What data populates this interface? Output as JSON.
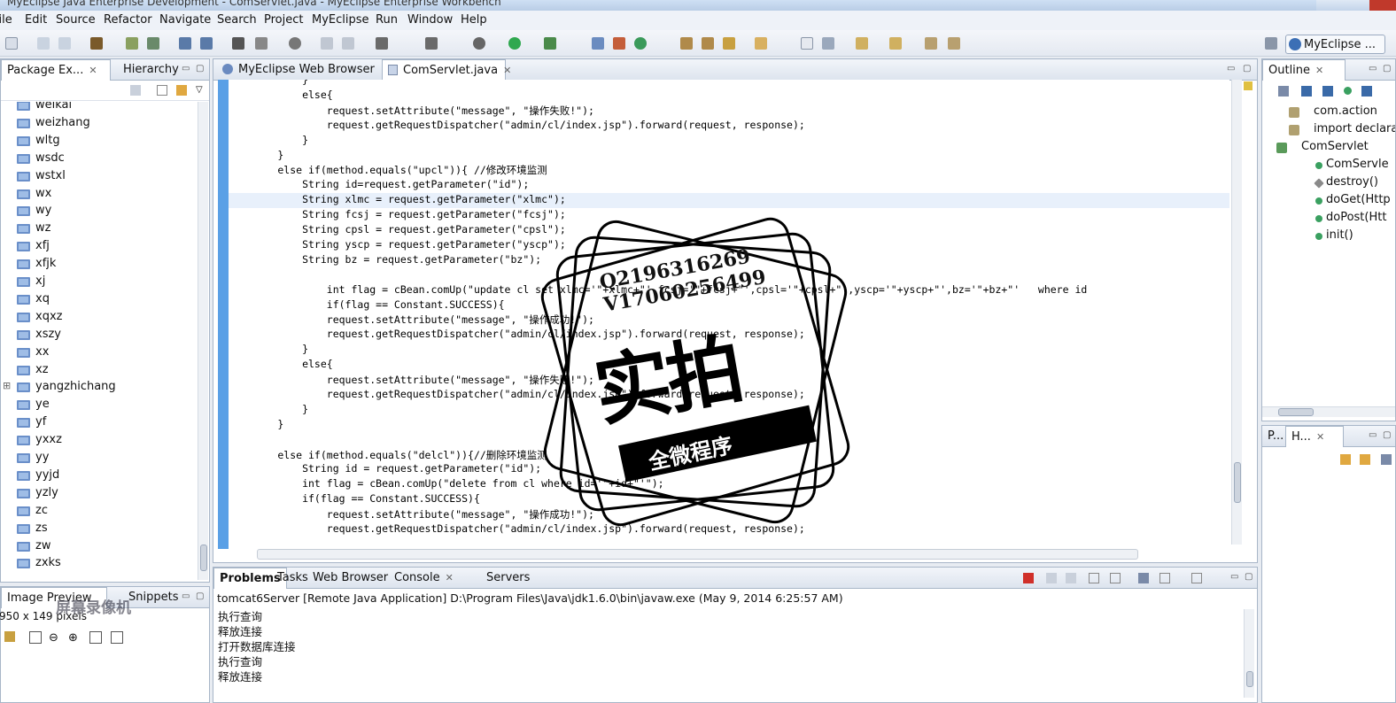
{
  "window": {
    "title": "MyEclipse Java Enterprise Development - ComServlet.java - MyEclipse Enterprise Workbench"
  },
  "menu": [
    "File",
    "Edit",
    "Source",
    "Refactor",
    "Navigate",
    "Search",
    "Project",
    "MyEclipse",
    "Run",
    "Window",
    "Help"
  ],
  "perspective": {
    "label": "MyEclipse ..."
  },
  "package_explorer": {
    "tabs": [
      "Package Ex...",
      "Hierarchy"
    ],
    "items": [
      "weikai",
      "weizhang",
      "wltg",
      "wsdc",
      "wstxl",
      "wx",
      "wy",
      "wz",
      "xfj",
      "xfjk",
      "xj",
      "xq",
      "xqxz",
      "xszy",
      "xx",
      "xz",
      "yangzhichang",
      "ye",
      "yf",
      "yxxz",
      "yy",
      "yyjd",
      "yzly",
      "zc",
      "zs",
      "zw",
      "zxks"
    ]
  },
  "image_preview": {
    "tabs": [
      "Image Preview",
      "Snippets"
    ],
    "size_text": "950 x 149 pixels"
  },
  "editor": {
    "tabs": [
      "MyEclipse Web Browser",
      "ComServlet.java"
    ],
    "lines": [
      "            }",
      "            else{",
      "                request.setAttribute(\"message\", \"操作失败!\");",
      "                request.getRequestDispatcher(\"admin/cl/index.jsp\").forward(request, response);",
      "            }",
      "        }",
      "        else if(method.equals(\"upcl\")){ //修改环境监测",
      "            String id=request.getParameter(\"id\");",
      "            String xlmc = request.getParameter(\"xlmc\");",
      "            String fcsj = request.getParameter(\"fcsj\");",
      "            String cpsl = request.getParameter(\"cpsl\");",
      "            String yscp = request.getParameter(\"yscp\");",
      "            String bz = request.getParameter(\"bz\");",
      "",
      "                int flag = cBean.comUp(\"update cl set xlmc='\"+xlmc+\"',fcsj='\"+fcsj+\"',cpsl='\"+cpsl+\"',yscp='\"+yscp+\"',bz='\"+bz+\"'   where id",
      "                if(flag == Constant.SUCCESS){",
      "                request.setAttribute(\"message\", \"操作成功!\");",
      "                request.getRequestDispatcher(\"admin/cl/index.jsp\").forward(request, response);",
      "            }",
      "            else{",
      "                request.setAttribute(\"message\", \"操作失败!\");",
      "                request.getRequestDispatcher(\"admin/cl/index.jsp\").forward(request, response);",
      "            }",
      "        }",
      "",
      "        else if(method.equals(\"delcl\")){//删除环境监测",
      "            String id = request.getParameter(\"id\");",
      "            int flag = cBean.comUp(\"delete from cl where id='\"+id+\"'\");",
      "            if(flag == Constant.SUCCESS){",
      "                request.setAttribute(\"message\", \"操作成功!\");",
      "                request.getRequestDispatcher(\"admin/cl/index.jsp\").forward(request, response);"
    ]
  },
  "outline": {
    "tab": "Outline",
    "items": [
      "com.action",
      "import declaratio",
      "ComServlet",
      "ComServle",
      "destroy()",
      "doGet(Http",
      "doPost(Htt",
      "init()"
    ]
  },
  "small_panel": {
    "tabs": [
      "P...",
      "H..."
    ]
  },
  "console": {
    "tabs": [
      "Problems",
      "Tasks",
      "Web Browser",
      "Console",
      "Servers"
    ],
    "header": "tomcat6Server [Remote Java Application] D:\\Program Files\\Java\\jdk1.6.0\\bin\\javaw.exe (May 9, 2014 6:25:57 AM)",
    "lines": [
      "执行查询",
      "释放连接",
      "打开数据库连接",
      "执行查询",
      "释放连接"
    ]
  },
  "overlay": {
    "stamp_text": "实拍",
    "stamp_sub": "全微程序",
    "contact": [
      "Q2196316269",
      "V17060256499"
    ],
    "watermark": [
      "屏幕录像机"
    ]
  }
}
